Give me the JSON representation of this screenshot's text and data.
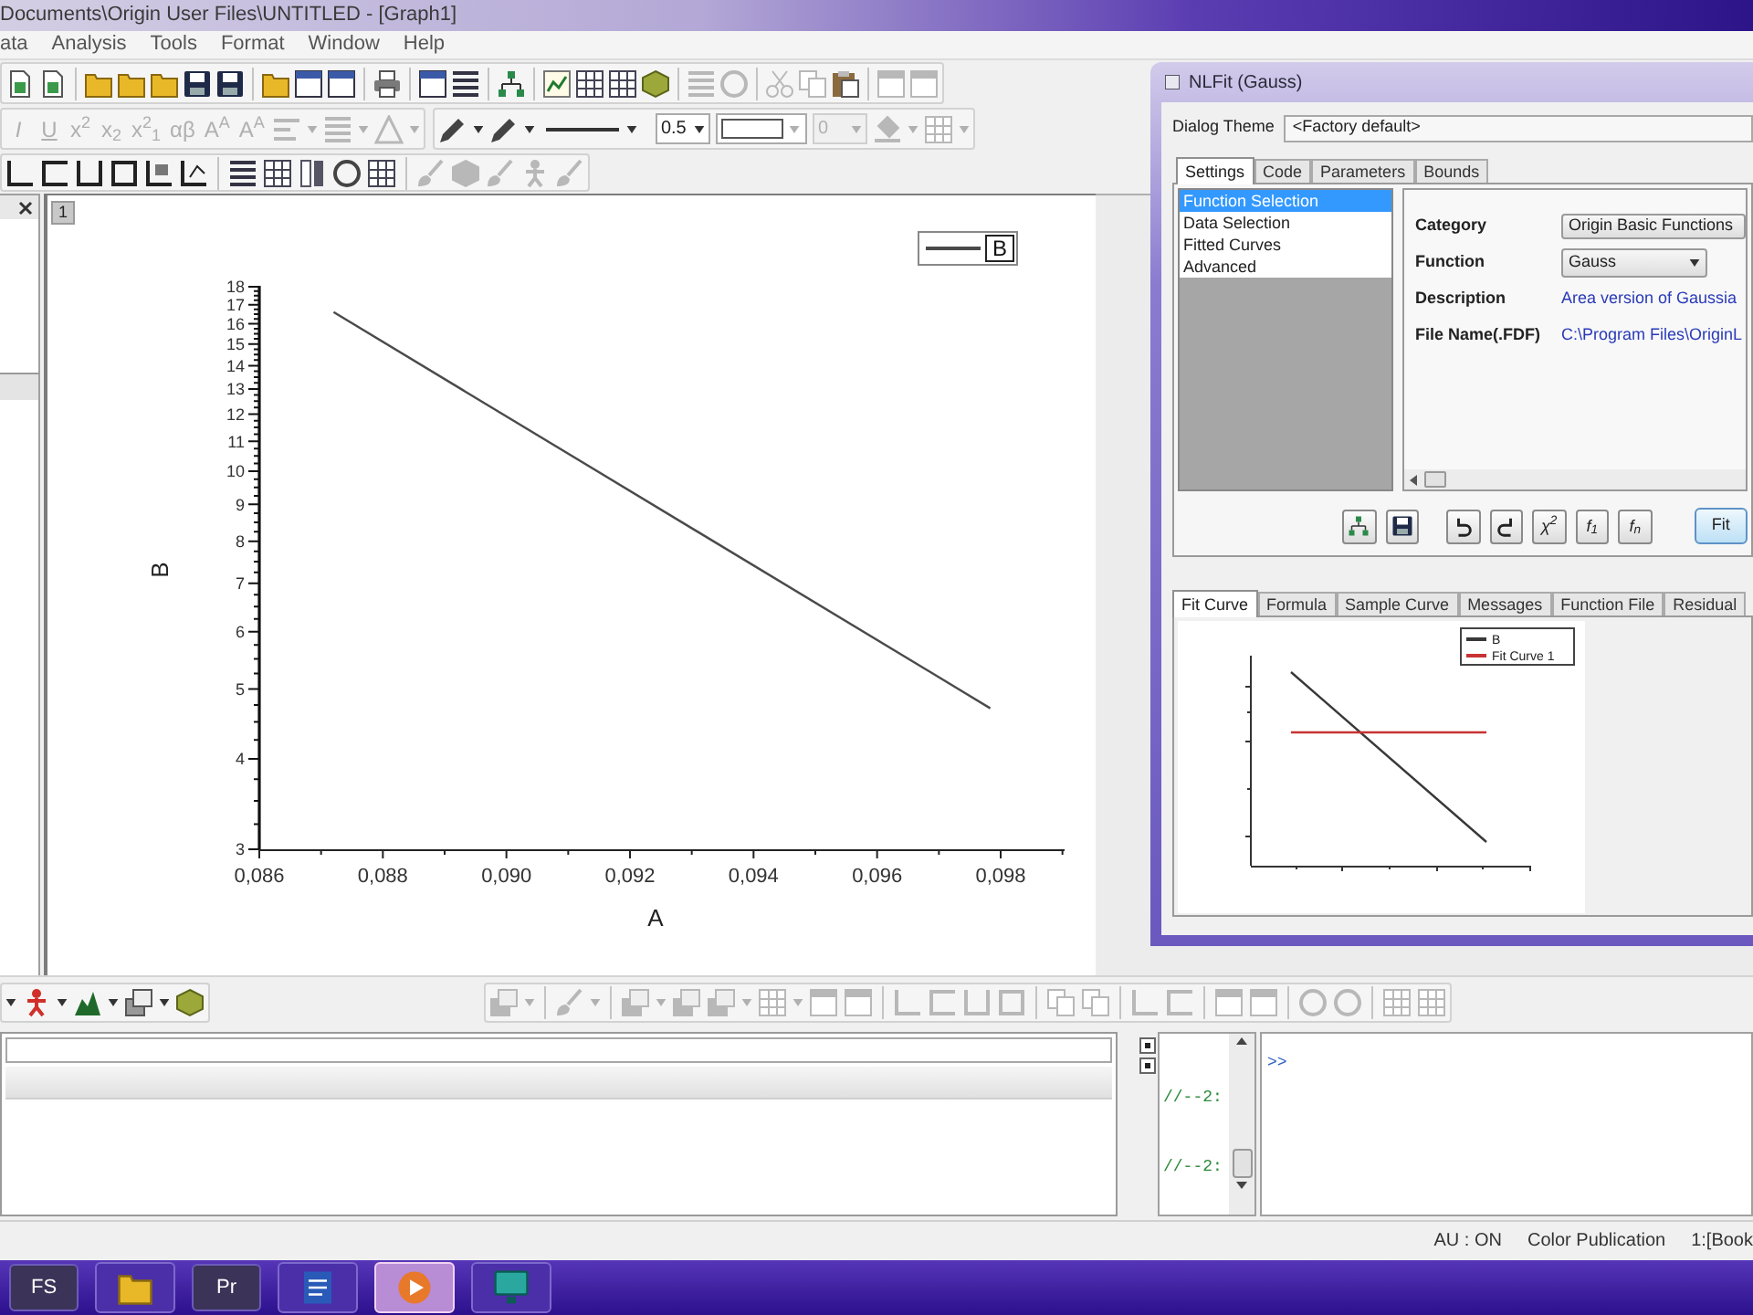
{
  "window": {
    "title": "Documents\\Origin User Files\\UNTITLED - [Graph1]"
  },
  "menu": [
    "ata",
    "Analysis",
    "Tools",
    "Format",
    "Window",
    "Help"
  ],
  "format_toolbar": {
    "text_buttons": [
      {
        "label": "I",
        "kind": "italic",
        "disabled": true
      },
      {
        "label": "U",
        "kind": "underline",
        "disabled": true
      },
      {
        "label": "x$^{2}$",
        "kind": "plain",
        "disabled": true
      },
      {
        "label": "x$_{2}$",
        "kind": "plain",
        "disabled": true
      },
      {
        "label": "x$^{2}$$_{1}$",
        "kind": "plain",
        "disabled": true
      },
      {
        "label": "αβ",
        "kind": "plain",
        "disabled": true
      },
      {
        "label": "A$^{A}$",
        "kind": "plain",
        "disabled": true
      },
      {
        "label": "A$^{A}$",
        "kind": "plain",
        "disabled": true
      }
    ],
    "fields": [
      {
        "value": "0.5",
        "disabled": false
      },
      {
        "value": "0",
        "disabled": true
      }
    ]
  },
  "graph": {
    "layer": "1",
    "legend": "B",
    "y_axis": {
      "title": "B",
      "tick_labels": [
        "18",
        "17",
        "16",
        "15",
        "14",
        "13",
        "12",
        "11",
        "10",
        "9",
        "8",
        "7",
        "6",
        "5",
        "4",
        "3"
      ]
    },
    "x_axis": {
      "title": "A",
      "tick_labels": [
        "0,086",
        "0,088",
        "0,090",
        "0,092",
        "0,094",
        "0,096",
        "0,098"
      ]
    }
  },
  "dialog": {
    "title": "NLFit (Gauss)",
    "theme_label": "Dialog Theme",
    "theme": "<Factory default>",
    "tabs": [
      {
        "label": "Settings",
        "selected": true
      },
      {
        "label": "Code",
        "selected": false
      },
      {
        "label": "Parameters",
        "selected": false
      },
      {
        "label": "Bounds",
        "selected": false
      }
    ],
    "sections": [
      {
        "label": "Function Selection",
        "selected": true
      },
      {
        "label": "Data Selection",
        "selected": false
      },
      {
        "label": "Fitted Curves",
        "selected": false
      },
      {
        "label": "Advanced",
        "selected": false
      }
    ],
    "fields": [
      {
        "label": "Category",
        "value": "Origin Basic Functions",
        "kind": "box"
      },
      {
        "label": "Function",
        "value": "Gauss",
        "kind": "select"
      },
      {
        "label": "Description",
        "value": "Area version of Gaussia",
        "kind": "link"
      },
      {
        "label": "File Name(.FDF)",
        "value": "C:\\Program Files\\OriginL",
        "kind": "link"
      }
    ],
    "tool_buttons": [
      "χ$^{2}$",
      "f$_{1}$",
      "f$_{n}$"
    ],
    "fit_button": "Fit",
    "result_tabs": [
      {
        "label": "Fit Curve",
        "selected": true
      },
      {
        "label": "Formula",
        "selected": false
      },
      {
        "label": "Sample Curve",
        "selected": false
      },
      {
        "label": "Messages",
        "selected": false
      },
      {
        "label": "Function File",
        "selected": false
      },
      {
        "label": "Residual",
        "selected": false
      }
    ],
    "preview": {
      "legend": [
        {
          "label": "B",
          "color": "#383838"
        },
        {
          "label": "Fit Curve 1",
          "color": "#c83232"
        }
      ]
    }
  },
  "command_window": {
    "history": [
      "//--2:",
      "//--2:"
    ],
    "prompt": ">>"
  },
  "status_bar": [
    "AU : ON",
    "Color Publication",
    "1:[Book"
  ],
  "taskbar": [
    {
      "kind": "label",
      "label": "FS",
      "selected": false
    },
    {
      "kind": "folder",
      "selected": false
    },
    {
      "kind": "label",
      "label": "Pr",
      "selected": false
    },
    {
      "kind": "document",
      "selected": false
    },
    {
      "kind": "media",
      "selected": true
    },
    {
      "kind": "monitor",
      "selected": false
    }
  ]
}
